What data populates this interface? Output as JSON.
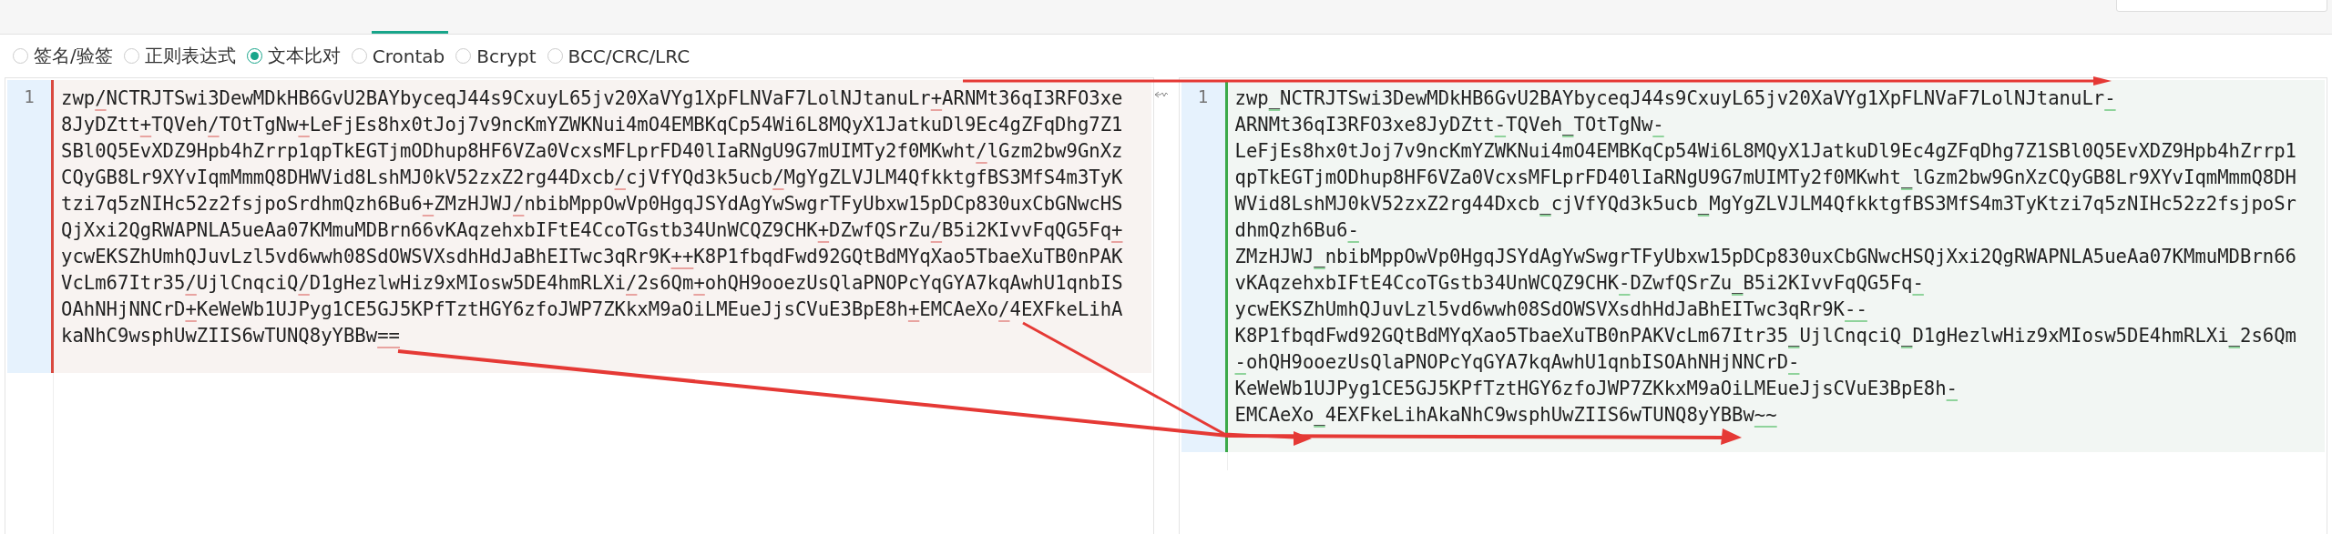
{
  "radio_options": [
    {
      "label": "签名/验签",
      "selected": false
    },
    {
      "label": "正则表达式",
      "selected": false
    },
    {
      "label": "文本比对",
      "selected": true
    },
    {
      "label": "Crontab",
      "selected": false
    },
    {
      "label": "Bcrypt",
      "selected": false
    },
    {
      "label": "BCC/CRC/LRC",
      "selected": false
    }
  ],
  "diff": {
    "left": {
      "line_number": "1",
      "text": "zwp/NCTRJTSwi3DewMDkHB6GvU2BAYbyceqJ44s9CxuyL65jv20XaVYg1XpFLNVaF7LolNJtanuLr+ARNMt36qI3RFO3xe8JyDZtt+TQVeh/TOtTgNw+LeFjEs8hx0tJoj7v9ncKmYZWKNui4mO4EMBKqCp54Wi6L8MQyX1JatkuDl9Ec4gZFqDhg7Z1SBl0Q5EvXDZ9Hpb4hZrrp1qpTkEGTjmODhup8HF6VZa0VcxsMFLprFD40lIaRNgU9G7mUIMTy2f0MKwht/lGzm2bw9GnXzCQyGB8Lr9XYvIqmMmmQ8DHWVid8LshMJ0kV52zxZ2rg44Dxcb/cjVfYQd3k5ucb/MgYgZLVJLM4QfkktgfBS3MfS4m3TyKtzi7q5zNIHc52z2fsjpoSrdhmQzh6Bu6+ZMzHJWJ/nbibMppOwVp0HgqJSYdAgYwSwgrTFyUbxw15pDCp830uxCbGNwcHSQjXxi2QgRWAPNLA5ueAa07KMmuMDBrn66vKAqzehxbIFtE4CcoTGstb34UnWCQZ9CHK+DZwfQSrZu/B5i2KIvvFqQG5Fq+ycwEKSZhUmhQJuvLzl5vd6wwh08SdOWSVXsdhHdJaBhEITwc3qRr9K++K8P1fbqdFwd92GQtBdMYqXao5TbaeXuTB0nPAKVcLm67Itr35/UjlCnqciQ/D1gHezlwHiz9xMIosw5DE4hmRLXi/2s6Qm+ohQH9ooezUsQlaPNOPcYqGYA7kqAwhU1qnbISOAhNHjNNCrD+KeWeWb1UJPyg1CE5GJ5KPfTztHGY6zfoJWP7ZKkxM9aOiLMEueJjsCVuE3BpE8h+EMCAeXo/4EXFkeLihAkaNhC9wsphUwZIIS6wTUNQ8yYBBw=="
    },
    "right": {
      "line_number": "1",
      "text": "zwp_NCTRJTSwi3DewMDkHB6GvU2BAYbyceqJ44s9CxuyL65jv20XaVYg1XpFLNVaF7LolNJtanuLr-ARNMt36qI3RFO3xe8JyDZtt-TQVeh_TOtTgNw-LeFjEs8hx0tJoj7v9ncKmYZWKNui4mO4EMBKqCp54Wi6L8MQyX1JatkuDl9Ec4gZFqDhg7Z1SBl0Q5EvXDZ9Hpb4hZrrp1qpTkEGTjmODhup8HF6VZa0VcxsMFLprFD40lIaRNgU9G7mUIMTy2f0MKwht_lGzm2bw9GnXzCQyGB8Lr9XYvIqmMmmQ8DHWVid8LshMJ0kV52zxZ2rg44Dxcb_cjVfYQd3k5ucb_MgYgZLVJLM4QfkktgfBS3MfS4m3TyKtzi7q5zNIHc52z2fsjpoSrdhmQzh6Bu6-ZMzHJWJ_nbibMppOwVp0HgqJSYdAgYwSwgrTFyUbxw15pDCp830uxCbGNwcHSQjXxi2QgRWAPNLA5ueAa07KMmuMDBrn66vKAqzehxbIFtE4CcoTGstb34UnWCQZ9CHK-DZwfQSrZu_B5i2KIvvFqQG5Fq-ycwEKSZhUmhQJuvLzl5vd6wwh08SdOWSVXsdhHdJaBhEITwc3qRr9K--K8P1fbqdFwd92GQtBdMYqXao5TbaeXuTB0nPAKVcLm67Itr35_UjlCnqciQ_D1gHezlwHiz9xMIosw5DE4hmRLXi_2s6Qm-ohQH9ooezUsQlaPNOPcYqGYA7kqAwhU1qnbISOAhNHjNNCrD-KeWeWb1UJPyg1CE5GJ5KPfTztHGY6zfoJWP7ZKkxM9aOiLMEueJjsCVuE3BpE8h-EMCAeXo_4EXFkeLihAkaNhC9wsphUwZIIS6wTUNQ8yYBBw~~"
    }
  }
}
